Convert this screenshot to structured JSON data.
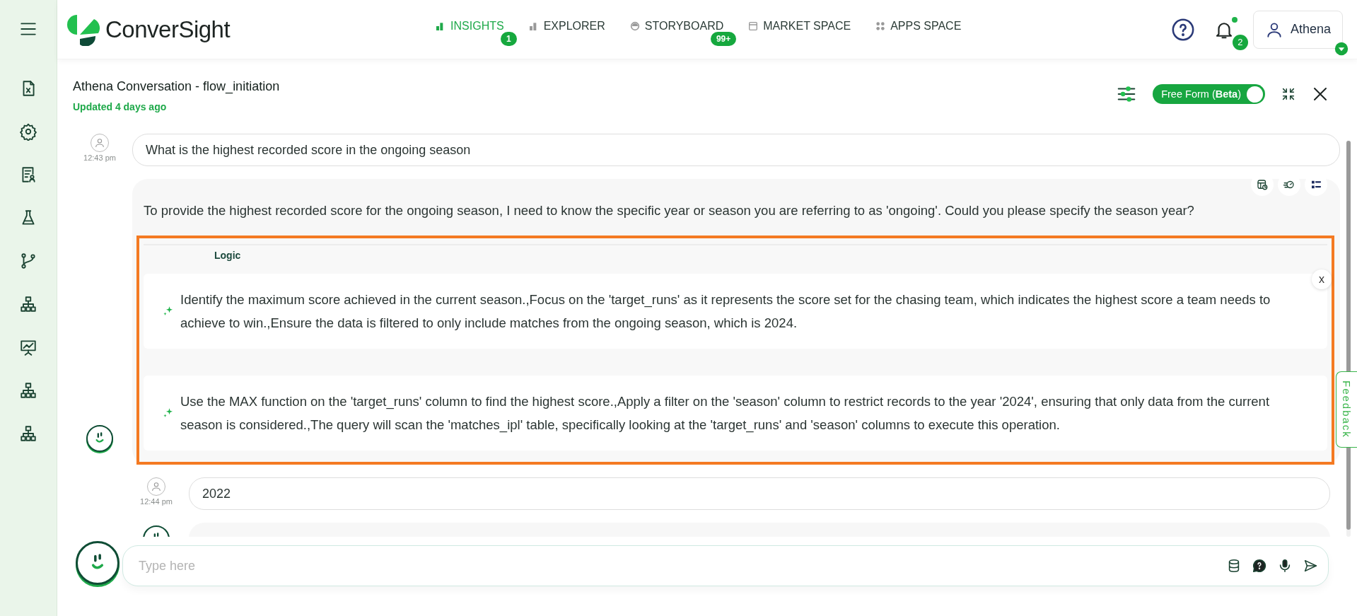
{
  "header": {
    "logo": "ConverSight",
    "nav": [
      {
        "label": "INSIGHTS",
        "selected": true,
        "badge": "1"
      },
      {
        "label": "EXPLORER",
        "selected": false
      },
      {
        "label": "STORYBOARD",
        "selected": false,
        "badge": "99+"
      },
      {
        "label": "MARKET SPACE",
        "selected": false
      },
      {
        "label": "APPS SPACE",
        "selected": false
      }
    ],
    "notifications": {
      "badge": "2",
      "unread": true
    },
    "user": {
      "name": "Athena"
    }
  },
  "conversation": {
    "title": "Athena Conversation - flow_initiation",
    "updated": "Updated 4 days ago",
    "free_form": {
      "label": "Free Form (**Beta**)",
      "on": true
    }
  },
  "messages": [
    {
      "kind": "user",
      "time": "12:43 pm",
      "text": "What is the highest recorded score in the ongoing season"
    },
    {
      "kind": "bot",
      "text": "To provide the highest recorded score for the ongoing season, I need to know the specific year or season you are referring to as 'ongoing'. Could you please specify the season year?",
      "logic": {
        "title": "Logic",
        "close": "x",
        "items": [
          "Identify the maximum score achieved in the current season.,Focus on the 'target_runs' as it represents the score set for the chasing team, which indicates the highest score a team needs to achieve to win.,Ensure the data is filtered to only include matches from the ongoing season, which is 2024.",
          "Use the MAX function on the 'target_runs' column to find the highest score.,Apply a filter on the 'season' column to restrict records to the year '2024', ensuring that only data from the current season is considered.,The query will scan the 'matches_ipl' table, specifically looking at the 'target_runs' and 'season' columns to execute this operation."
        ]
      }
    },
    {
      "kind": "user",
      "time": "12:44 pm",
      "text": "2022"
    },
    {
      "kind": "bot"
    }
  ],
  "input": {
    "placeholder": "Type here"
  },
  "feedback": "Feedback"
}
